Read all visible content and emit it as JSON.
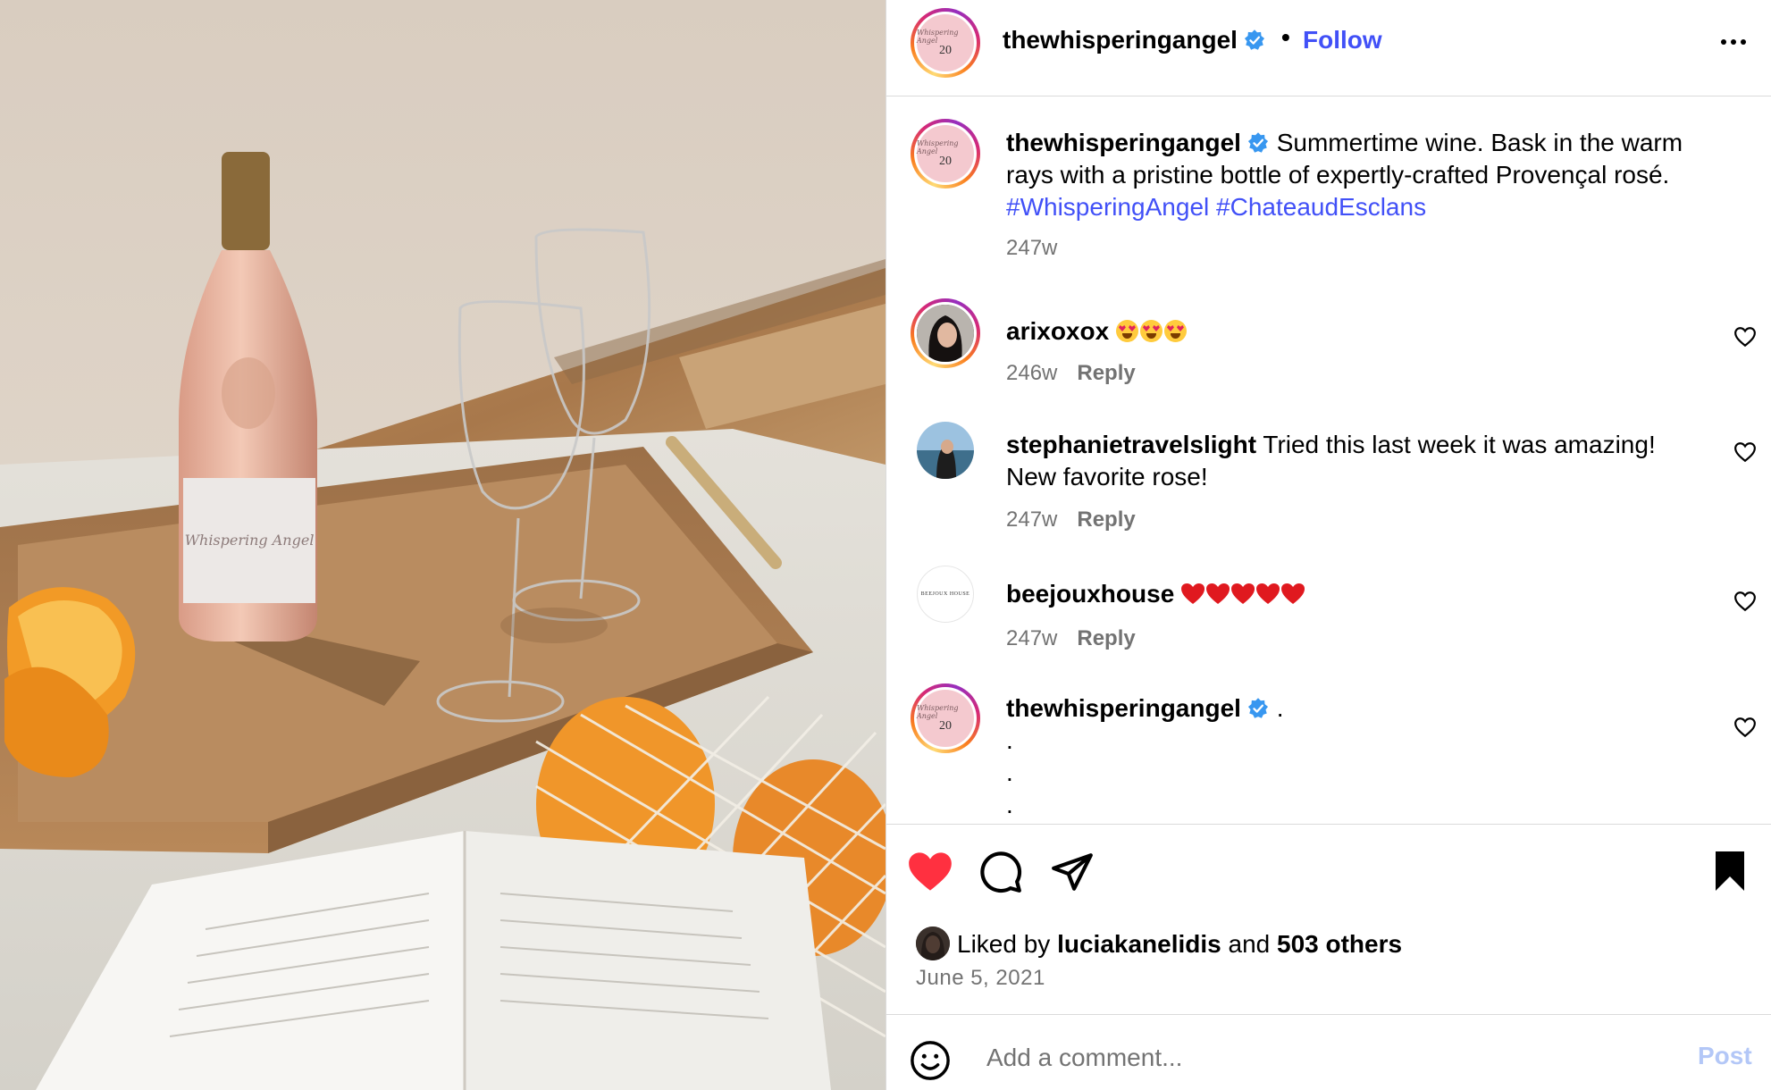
{
  "post": {
    "username": "thewhisperingangel",
    "follow_label": "Follow",
    "separator": "•",
    "avatar_script": "Whispering Angel",
    "avatar_number": "20"
  },
  "comments": [
    {
      "username": "thewhisperingangel",
      "text": "Summertime wine. Bask in the warm rays with a pristine bottle of expertly-crafted Provençal rosé.",
      "hashtags": [
        "#WhisperingAngel",
        "#ChateaudEsclans"
      ],
      "age": "247w"
    },
    {
      "username": "arixoxox",
      "emojis": [
        "heart-eyes-emoji",
        "heart-eyes-emoji",
        "heart-eyes-emoji"
      ],
      "age": "246w",
      "reply_label": "Reply"
    },
    {
      "username": "stephanietravelslight",
      "text": "Tried this last week it was amazing! New favorite rose!",
      "age": "247w",
      "reply_label": "Reply"
    },
    {
      "username": "beejouxhouse",
      "emojis": [
        "red-heart-emoji",
        "red-heart-emoji",
        "red-heart-emoji",
        "red-heart-emoji",
        "red-heart-emoji"
      ],
      "avatar_text": "BEEJOUX HOUSE",
      "age": "247w",
      "reply_label": "Reply"
    },
    {
      "username": "thewhisperingangel",
      "text_lines": [
        ".",
        ".",
        ".",
        "."
      ]
    }
  ],
  "likes": {
    "prefix": "Liked by",
    "user": "luciakanelidis",
    "and": "and",
    "others": "503 others"
  },
  "date": "June 5, 2021",
  "comment_box": {
    "placeholder": "Add a comment...",
    "post_label": "Post"
  },
  "colors": {
    "link_blue": "#4150f7",
    "verified_blue": "#3897f0",
    "like_red": "#ff3040",
    "muted": "#737373",
    "post_disabled": "#b3c7f7"
  },
  "icons": [
    "verified-badge-icon",
    "more-options-icon",
    "heart-icon",
    "comment-icon",
    "share-icon",
    "bookmark-icon",
    "emoji-icon"
  ]
}
